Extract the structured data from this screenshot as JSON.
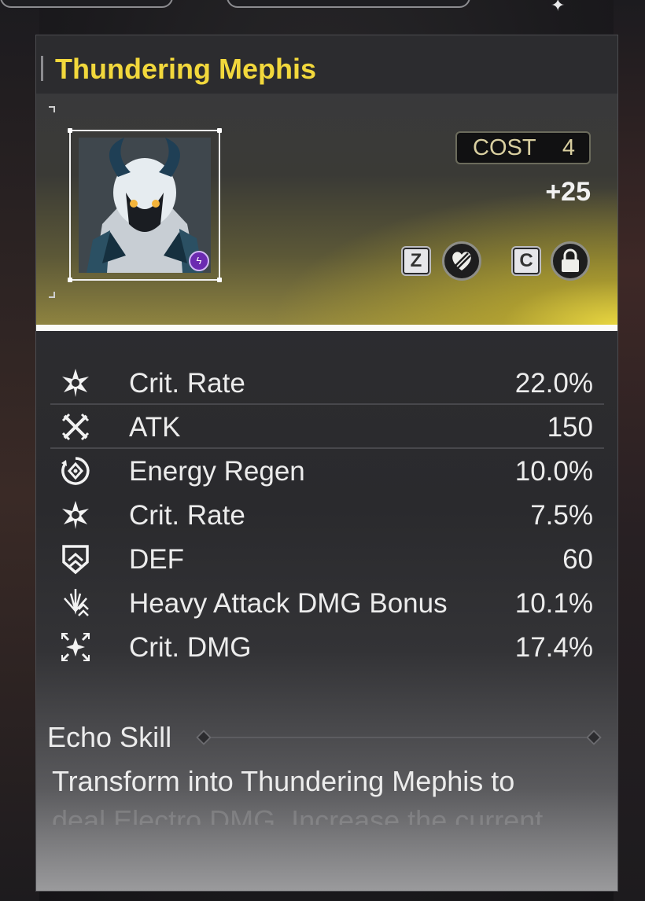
{
  "echo": {
    "name": "Thundering Mephis",
    "cost_label": "COST",
    "cost_value": "4",
    "level": "+25"
  },
  "controls": {
    "favorite_key": "Z",
    "lock_key": "C"
  },
  "stats": [
    {
      "icon": "crit-rate-icon",
      "name": "Crit. Rate",
      "value": "22.0%"
    },
    {
      "icon": "atk-icon",
      "name": "ATK",
      "value": "150"
    },
    {
      "icon": "energy-regen-icon",
      "name": "Energy Regen",
      "value": "10.0%"
    },
    {
      "icon": "crit-rate-icon",
      "name": "Crit. Rate",
      "value": "7.5%"
    },
    {
      "icon": "def-icon",
      "name": "DEF",
      "value": "60"
    },
    {
      "icon": "heavy-attack-icon",
      "name": "Heavy Attack DMG Bonus",
      "value": "10.1%"
    },
    {
      "icon": "crit-dmg-icon",
      "name": "Crit. DMG",
      "value": "17.4%"
    }
  ],
  "skill": {
    "heading": "Echo Skill",
    "description": "Transform into Thundering Mephis to",
    "description_faded": "deal Electro DMG. Increase the current"
  },
  "colors": {
    "title": "#f2d83c",
    "hero_glow": "#e8d640",
    "stat_text": "#ececec"
  }
}
